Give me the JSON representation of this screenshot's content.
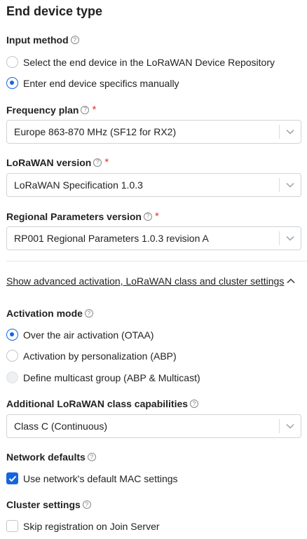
{
  "section_title": "End device type",
  "input_method": {
    "label": "Input method",
    "help": "?",
    "options": [
      {
        "label": "Select the end device in the LoRaWAN Device Repository",
        "checked": false
      },
      {
        "label": "Enter end device specifics manually",
        "checked": true
      }
    ]
  },
  "frequency_plan": {
    "label": "Frequency plan",
    "help": "?",
    "required": "*",
    "value": "Europe 863-870 MHz (SF12 for RX2)"
  },
  "lorawan_version": {
    "label": "LoRaWAN version",
    "help": "?",
    "required": "*",
    "value": "LoRaWAN Specification 1.0.3"
  },
  "regional_parameters": {
    "label": "Regional Parameters version",
    "help": "?",
    "required": "*",
    "value": "RP001 Regional Parameters 1.0.3 revision A"
  },
  "advanced_toggle": {
    "label": "Show advanced activation, LoRaWAN class and cluster settings",
    "icon": "chevron-up-icon"
  },
  "activation_mode": {
    "label": "Activation mode",
    "help": "?",
    "options": [
      {
        "label": "Over the air activation (OTAA)",
        "checked": true
      },
      {
        "label": "Activation by personalization (ABP)",
        "checked": false
      },
      {
        "label": "Define multicast group (ABP & Multicast)",
        "checked": false,
        "disabled": true
      }
    ]
  },
  "class_capabilities": {
    "label": "Additional LoRaWAN class capabilities",
    "help": "?",
    "value": "Class C (Continuous)"
  },
  "network_defaults": {
    "label": "Network defaults",
    "help": "?",
    "checkbox_label": "Use network's default MAC settings",
    "checked": true
  },
  "cluster_settings": {
    "label": "Cluster settings",
    "help": "?",
    "checkbox_label": "Skip registration on Join Server",
    "checked": false
  },
  "colors": {
    "accent": "#1466e0",
    "required": "#e5352f",
    "border": "#d0d4d9"
  }
}
